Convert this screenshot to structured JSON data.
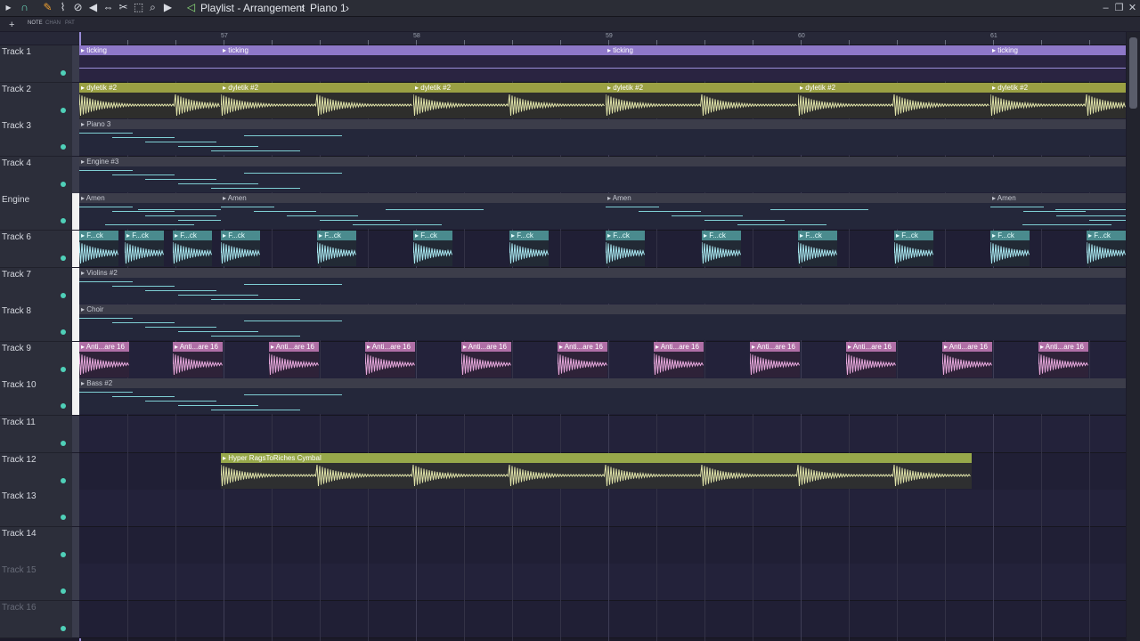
{
  "toolbar": {
    "title": "Playlist - Arrangement",
    "separator": "›",
    "pattern": "Piano 1",
    "pattern_arrow": "›",
    "icons": [
      "magnet-icon",
      "pencil-icon",
      "paint-icon",
      "delete-icon",
      "mute-icon",
      "slip-icon",
      "slice-icon",
      "select-icon",
      "zoom-icon",
      "play-icon",
      "playlist-icon"
    ]
  },
  "subbar": {
    "note_label": "NOTE",
    "chan_label": "CHAN",
    "pat_label": "PAT"
  },
  "ruler": {
    "bars": [
      "57",
      "58",
      "59",
      "60",
      "61"
    ]
  },
  "tracks": [
    {
      "name": "Track 1",
      "dim": false,
      "white": false
    },
    {
      "name": "Track 2",
      "dim": false,
      "white": false
    },
    {
      "name": "Track 3",
      "dim": false,
      "white": false
    },
    {
      "name": "Track 4",
      "dim": false,
      "white": false
    },
    {
      "name": "Engine",
      "dim": false,
      "white": true
    },
    {
      "name": "Track 6",
      "dim": false,
      "white": true
    },
    {
      "name": "Track 7",
      "dim": false,
      "white": true
    },
    {
      "name": "Track 8",
      "dim": false,
      "white": true
    },
    {
      "name": "Track 9",
      "dim": false,
      "white": true
    },
    {
      "name": "Track 10",
      "dim": false,
      "white": true
    },
    {
      "name": "Track 11",
      "dim": false,
      "white": false
    },
    {
      "name": "Track 12",
      "dim": false,
      "white": false
    },
    {
      "name": "Track 13",
      "dim": false,
      "white": false
    },
    {
      "name": "Track 14",
      "dim": false,
      "white": false
    },
    {
      "name": "Track 15",
      "dim": true,
      "white": false
    },
    {
      "name": "Track 16",
      "dim": true,
      "white": false
    }
  ],
  "clips": {
    "ticking": "ticking",
    "dyletik": "dyletik #2",
    "piano": "Piano 3",
    "engine": "Engine #3",
    "amen": "Amen",
    "fck": "F...ck",
    "violins": "Violins #2",
    "choir": "Choir",
    "anti": "Anti...are 16",
    "bass": "Bass #2",
    "cymbal": "Hyper RagsToRiches Cymbal"
  },
  "colors": {
    "accent": "#9a8cd8",
    "dot": "#4fd0b8"
  }
}
